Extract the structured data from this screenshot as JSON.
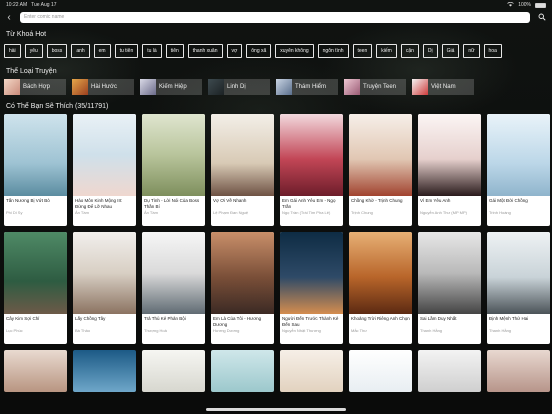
{
  "status": {
    "time": "10:22 AM",
    "date": "Tue Aug 17",
    "battery_text": "100%",
    "battery_level": 1.0
  },
  "search": {
    "placeholder": "Enter comic name",
    "value": ""
  },
  "hot": {
    "title": "Từ Khoá Hot",
    "keywords": [
      "hài",
      "yêu",
      "boss",
      "anh",
      "em",
      "tu tiên",
      "tu là",
      "tiên",
      "thanh xuân",
      "vợ",
      "ông xã",
      "xuyên không",
      "ngôn tình",
      "teen",
      "kiếm",
      "cặn",
      "Dị",
      "Giá",
      "nữ",
      "hoa"
    ]
  },
  "categories": {
    "title": "Thể Loại Truyện",
    "items": [
      {
        "label": "Bách Hợp",
        "thumb_class": "t1"
      },
      {
        "label": "Hài Hước",
        "thumb_class": "t2"
      },
      {
        "label": "Kiếm Hiệp",
        "thumb_class": "t3"
      },
      {
        "label": "Linh Dị",
        "thumb_class": "t4"
      },
      {
        "label": "Thám Hiểm",
        "thumb_class": "t5"
      },
      {
        "label": "Truyện Teen",
        "thumb_class": "t6"
      },
      {
        "label": "Việt Nam",
        "thumb_class": "t7"
      }
    ]
  },
  "recommend": {
    "title": "Có Thể Bạn Sẽ Thích (35/11791)",
    "books": [
      {
        "title": "Tấn Nương Bị Vứt Bỏ",
        "author": "Phi Di Sy",
        "cover": "c1"
      },
      {
        "title": "Hào Môn Kinh Mộng III: Đừng Để Lỡ Nhau",
        "author": "Ân Tầm",
        "cover": "c2"
      },
      {
        "title": "Dụ Tình - Lời Nói Của Boss Thần Bí",
        "author": "Ân Tầm",
        "cover": "c3"
      },
      {
        "title": "Vợ Ơi Về Nhanh",
        "author": "Lệ Phạm Đan Nguệ",
        "cover": "c4"
      },
      {
        "title": "Em Gái Anh Yêu Em - Ngọ Trần",
        "author": "Ngọ Trần (Trái Tim Pha Lê)",
        "cover": "c5"
      },
      {
        "title": "Chồng Khờ - Trịnh Chung",
        "author": "Trịnh Chung",
        "cover": "c6"
      },
      {
        "title": "Vì Em Yêu Anh",
        "author": "Nguyễn Anh Thư (MP MP)",
        "cover": "c7"
      },
      {
        "title": "Gái Một Đời Chồng",
        "author": "Trinh Hoàng",
        "cover": "c8"
      },
      {
        "title": "Cây Kim Sợi Chỉ",
        "author": "Lục Phúc",
        "cover": "d1"
      },
      {
        "title": "Lấy Chồng Tây",
        "author": "Bà Thảo",
        "cover": "d2"
      },
      {
        "title": "Trả Thù Kẻ Phản Bội",
        "author": "Thượng Hoả",
        "cover": "d3"
      },
      {
        "title": "Em Là Của Tôi - Hương Dương",
        "author": "Hương Dương",
        "cover": "d4"
      },
      {
        "title": "Người Đến Trước Thành Kẻ Đến Sau",
        "author": "Nguyễn Nhật Thương",
        "cover": "d5"
      },
      {
        "title": "Khoảng Trời Riêng Anh Chọn",
        "author": "Mắc Thư",
        "cover": "d6"
      },
      {
        "title": "Sai Lầm Duy Nhất",
        "author": "Thanh Hằng",
        "cover": "d7"
      },
      {
        "title": "Định Mệnh Thứ Hai",
        "author": "Thanh Hằng",
        "cover": "d8"
      },
      {
        "title": "",
        "author": "",
        "cover": "e1"
      },
      {
        "title": "",
        "author": "",
        "cover": "e2"
      },
      {
        "title": "",
        "author": "",
        "cover": "e3"
      },
      {
        "title": "",
        "author": "",
        "cover": "e4"
      },
      {
        "title": "",
        "author": "",
        "cover": "e5"
      },
      {
        "title": "",
        "author": "",
        "cover": "e6"
      },
      {
        "title": "",
        "author": "",
        "cover": "e7"
      },
      {
        "title": "",
        "author": "",
        "cover": "e8"
      }
    ]
  },
  "icons": {
    "back": "chevron-left-icon",
    "search": "search-icon"
  },
  "colors": {
    "background": "#0b0d0c",
    "card": "#ffffff",
    "chip_border": "#e6e6e6",
    "search_field": "#ffffff"
  }
}
